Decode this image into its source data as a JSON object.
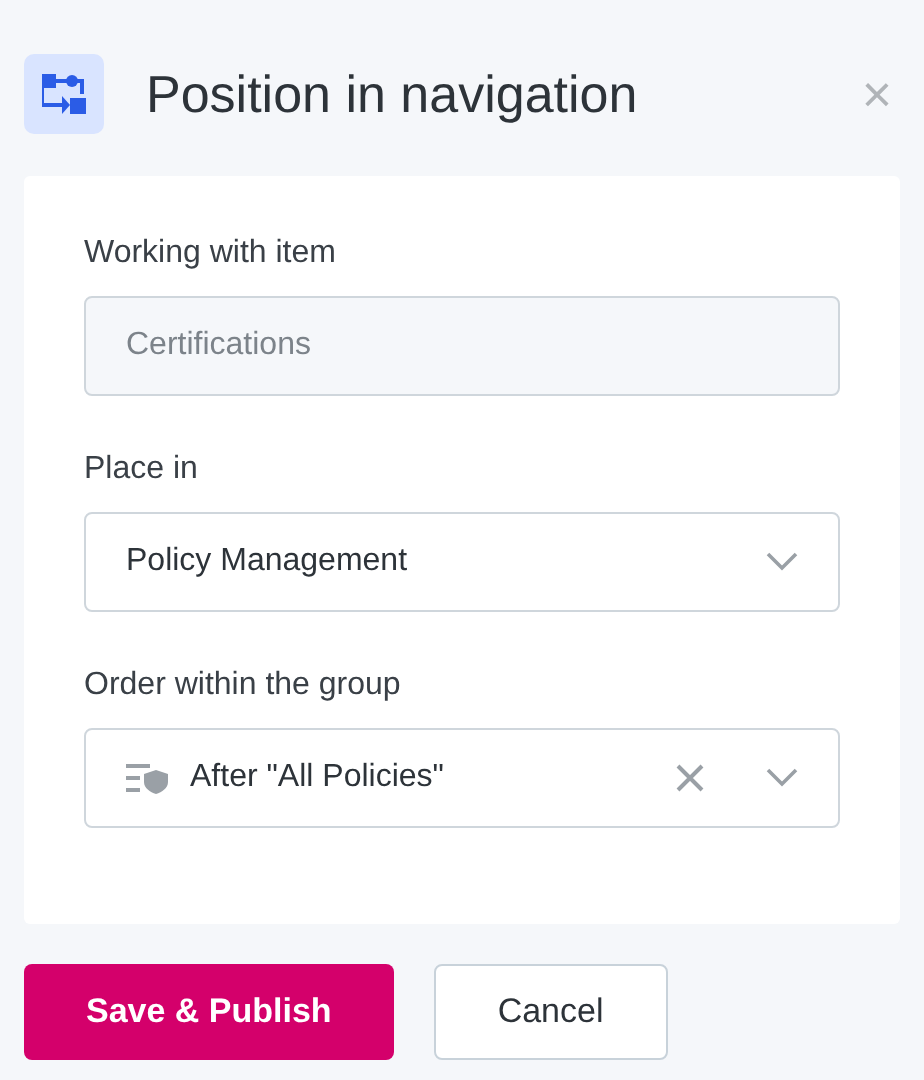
{
  "dialog": {
    "title": "Position in navigation",
    "close": "×"
  },
  "fields": [
    {
      "kind": "readonly",
      "label": "Working with item",
      "value": "Certifications"
    },
    {
      "kind": "select",
      "label": "Place in",
      "value": "Policy Management"
    },
    {
      "kind": "select-clearable",
      "label": "Order within the group",
      "value": "After \"All Policies\""
    }
  ],
  "buttons": [
    {
      "kind": "primary",
      "label": "Save & Publish"
    },
    {
      "kind": "secondary",
      "label": "Cancel"
    }
  ]
}
